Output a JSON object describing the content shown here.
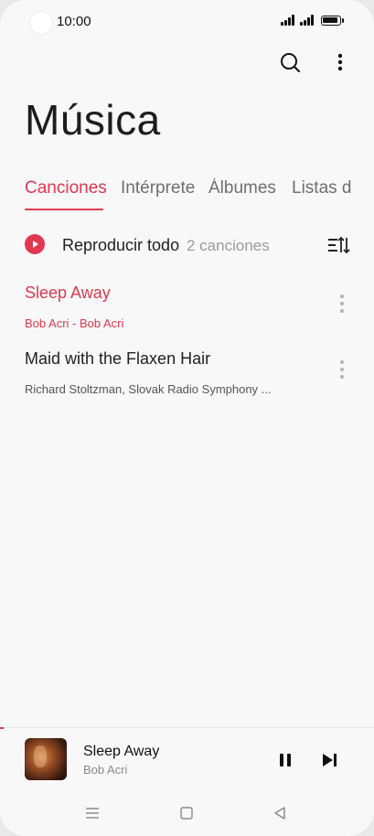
{
  "status_bar": {
    "time": "10:00"
  },
  "header": {
    "title": "Música"
  },
  "tabs": [
    {
      "label": "Canciones",
      "active": true
    },
    {
      "label": "Intérprete",
      "active": false
    },
    {
      "label": "Álbumes",
      "active": false
    },
    {
      "label": "Listas d",
      "active": false
    }
  ],
  "play_all": {
    "label": "Reproducir todo",
    "count": "2 canciones"
  },
  "songs": [
    {
      "title": "Sleep Away",
      "subtitle": "Bob Acri - Bob Acri",
      "playing": true
    },
    {
      "title": "Maid with the Flaxen Hair",
      "subtitle": "Richard Stoltzman, Slovak Radio Symphony ...",
      "playing": false
    }
  ],
  "now_playing": {
    "title": "Sleep Away",
    "artist": "Bob Acri",
    "progress_fraction": 0.01
  },
  "colors": {
    "accent": "#e0384f",
    "background": "#f8f8f8",
    "text": "#222222"
  },
  "icons": {
    "search": "search-icon",
    "more": "more-vertical-icon",
    "sort": "sort-icon",
    "pause": "pause-icon",
    "next": "skip-next-icon",
    "nav_menu": "menu-icon",
    "nav_home": "home-square-icon",
    "nav_back": "back-triangle-icon"
  }
}
